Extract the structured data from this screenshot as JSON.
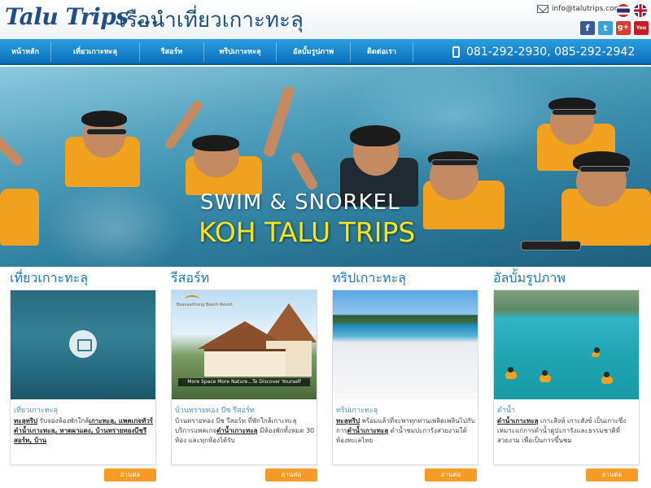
{
  "header": {
    "logo_latin": "Talu Trips ...",
    "logo_thai": "เรือนำเที่ยวเกาะทะลุ",
    "email": "info@talutrips.com",
    "languages": [
      "thai-flag-icon",
      "english-flag-icon"
    ],
    "social": [
      {
        "name": "facebook-icon",
        "glyph": "f",
        "color": "#3b5998"
      },
      {
        "name": "twitter-icon",
        "glyph": "t",
        "color": "#35a2dc"
      },
      {
        "name": "google-plus-icon",
        "glyph": "g+",
        "color": "#d73d32"
      },
      {
        "name": "youtube-icon",
        "glyph": "You Tube",
        "color": "#cc181e"
      }
    ]
  },
  "nav": {
    "items": [
      {
        "label": "หน้าหลัก"
      },
      {
        "label": "เที่ยวเกาะทะลุ"
      },
      {
        "label": "รีสอร์ท"
      },
      {
        "label": "ทริปเกาะทะลุ"
      },
      {
        "label": "อัลบั้มรูปภาพ"
      },
      {
        "label": "ติดต่อเรา"
      }
    ],
    "phone": "081-292-2930, 085-292-2942"
  },
  "hero": {
    "line1": "SWIM & SNORKEL",
    "line2": "KOH TALU TRIPS"
  },
  "columns": [
    {
      "title": "เที่ยวเกาะทะลุ",
      "subtitle": "เที่ยวเกาะทะลุ",
      "desc_bold": "ทะลุทริป",
      "desc_text": " รับจองห้องพักใกล้",
      "desc_link": "เกาะทะลุ, แพคเกจทัวร์ดำน้ำเกาะทะลุ, หาดผาแดง, บ้านทรายทองบีชรีสอร์ท, บ้าน",
      "button": "อ่านต่อ"
    },
    {
      "title": "รีสอร์ท",
      "subtitle": "บ้านทรายทอง บีช รีสอร์ท",
      "desc_bold": "",
      "desc_text": "บ้านทรายทอง บีช รีสอร์ท ที่พักใกล้เกาะทะลุ บริการแพคเกจ",
      "desc_link": "ดำน้ำเกาะทะลุ",
      "desc_tail": " มีห้องพักทั้งหมด 30 ห้อง และทุกห้องได้รับ",
      "image_logo": "Baansaithong Beach Resort",
      "image_banner": "More Space More Nature...To Discover Yourself",
      "button": "อ่านต่อ"
    },
    {
      "title": "ทริปเกาะทะลุ",
      "subtitle": "ทริปเกาะทะลุ",
      "desc_bold": "ทะลุทริป",
      "desc_text": " พร้อมแล้วที่จะพาทุกท่านเพลิดเพลินไปกับการ",
      "desc_link": "ดำน้ำเกาะทะลุ",
      "desc_tail": " ดำน้ำชมปะการังสวยงามใต้ท้องทะเลไทย",
      "button": "อ่านต่อ"
    },
    {
      "title": "อัลบั้มรูปภาพ",
      "subtitle": "ดำน้ำ",
      "desc_bold": "",
      "desc_text": "",
      "desc_link": "ดำน้ำเกาะทะลุ",
      "desc_tail": " เกาะสิงห์ เกาะสังข์ เป็นเกาะซึ่งเหมาะแก่การดำน้ำดูปะการังและธรรมชาติที่สวยงาม เพื่อเป็นการขึ้นชม",
      "button": "อ่านต่อ"
    }
  ],
  "colors": {
    "nav_top": "#2a9fe0",
    "nav_bottom": "#0a6fbb",
    "accent_title": "#1e78c0",
    "button": "#f59b26",
    "hero_yellow": "#f5e51a"
  }
}
